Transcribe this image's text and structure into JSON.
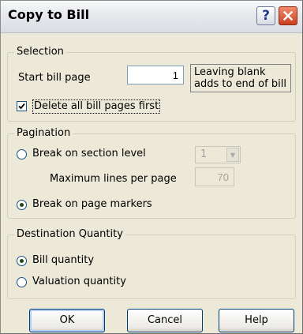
{
  "title": "Copy to Bill",
  "selection": {
    "legend": "Selection",
    "start_bill_page_label": "Start bill page",
    "start_bill_page_value": "1",
    "note_line1": "Leaving blank",
    "note_line2": "adds to end of bill",
    "delete_pages_label": "Delete all bill pages first",
    "delete_pages_checked": true
  },
  "pagination": {
    "legend": "Pagination",
    "break_section_label": "Break on section level",
    "section_level_value": "1",
    "max_lines_label": "Maximum lines per page",
    "max_lines_value": "70",
    "break_markers_label": "Break on page markers",
    "selected": "break_markers"
  },
  "destination": {
    "legend": "Destination Quantity",
    "bill_quantity_label": "Bill quantity",
    "valuation_quantity_label": "Valuation quantity",
    "selected": "bill_quantity"
  },
  "buttons": {
    "ok": "OK",
    "cancel": "Cancel",
    "help": "Help"
  },
  "icons": {
    "help": "help-question-icon",
    "close": "close-x-icon"
  },
  "colors": {
    "dialog_bg": "#ece9d8",
    "close_button": "#c8401e"
  }
}
